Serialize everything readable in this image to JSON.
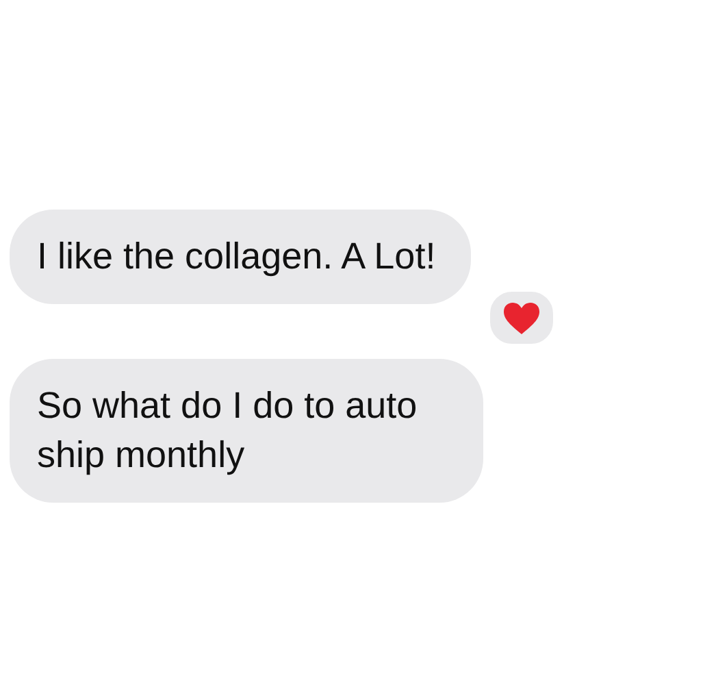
{
  "messages": [
    {
      "text": "I like the collagen. A Lot!",
      "hearted": true
    },
    {
      "text": "So what do I do to auto ship monthly"
    }
  ]
}
